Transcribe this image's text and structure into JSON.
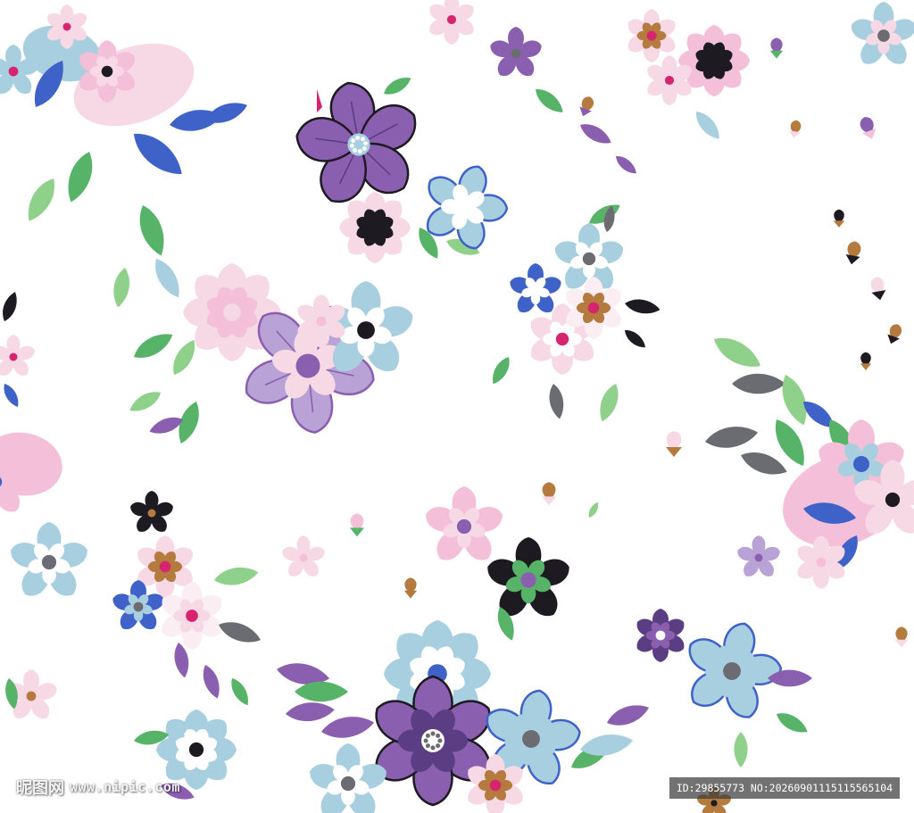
{
  "image": {
    "subject": "seamless floral pattern",
    "background_color": "#ffffff",
    "palette": {
      "purple": "#8b5fb0",
      "deep_purple": "#5a3d82",
      "lavender": "#b9a3d6",
      "blue": "#3e62c8",
      "light_blue": "#a8cfe0",
      "pink": "#f4bfd8",
      "light_pink": "#f7d9e6",
      "green": "#57b368",
      "light_green": "#8fd08a",
      "gray": "#6b6b72",
      "black": "#1e1a22",
      "brown": "#b57a3e",
      "magenta": "#d6246e"
    }
  },
  "watermark": {
    "brand": "昵图网",
    "url": "www.nipic.com",
    "id_text": "ID:29855773 NO:20260901115115565104"
  }
}
